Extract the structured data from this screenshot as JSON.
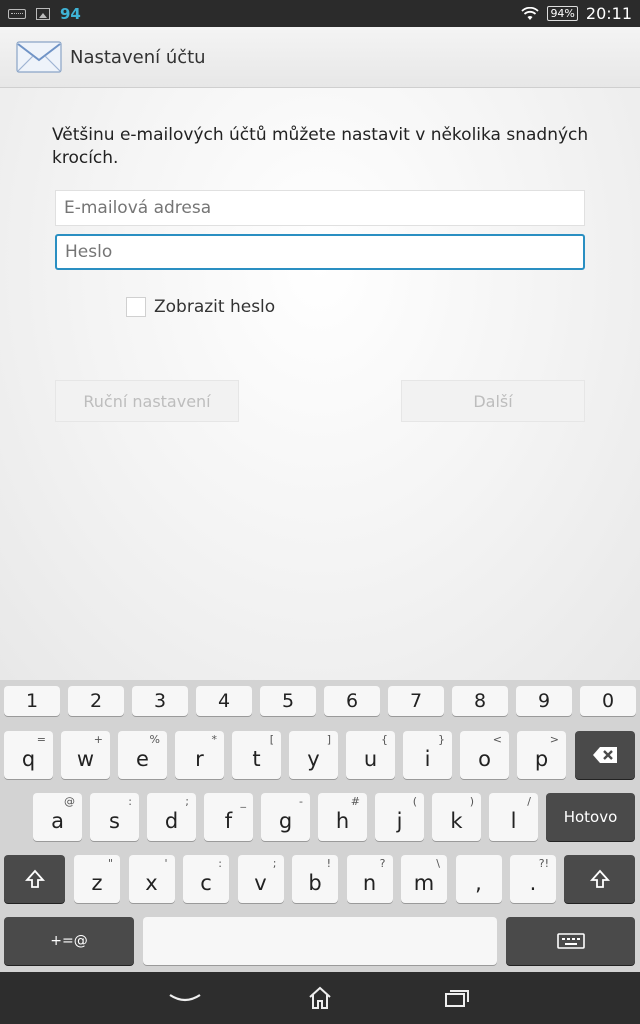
{
  "status_bar": {
    "notification_count": "94",
    "battery": "94%",
    "time": "20:11"
  },
  "action_bar": {
    "title": "Nastavení účtu"
  },
  "form": {
    "intro": "Většinu e-mailových účtů můžete nastavit v několika snadných krocích.",
    "email_placeholder": "E-mailová adresa",
    "password_placeholder": "Heslo",
    "show_password_label": "Zobrazit heslo",
    "manual_setup_label": "Ruční nastavení",
    "next_label": "Další"
  },
  "keyboard": {
    "numbers": [
      "1",
      "2",
      "3",
      "4",
      "5",
      "6",
      "7",
      "8",
      "9",
      "0"
    ],
    "row1": [
      {
        "k": "q",
        "s": "="
      },
      {
        "k": "w",
        "s": "+"
      },
      {
        "k": "e",
        "s": "%"
      },
      {
        "k": "r",
        "s": "*"
      },
      {
        "k": "t",
        "s": "["
      },
      {
        "k": "y",
        "s": "]"
      },
      {
        "k": "u",
        "s": "{"
      },
      {
        "k": "i",
        "s": "}"
      },
      {
        "k": "o",
        "s": "<"
      },
      {
        "k": "p",
        "s": ">"
      }
    ],
    "row2": [
      {
        "k": "a",
        "s": "@"
      },
      {
        "k": "s",
        "s": ":"
      },
      {
        "k": "d",
        "s": ";"
      },
      {
        "k": "f",
        "s": "_"
      },
      {
        "k": "g",
        "s": "-"
      },
      {
        "k": "h",
        "s": "#"
      },
      {
        "k": "j",
        "s": "("
      },
      {
        "k": "k",
        "s": ")"
      },
      {
        "k": "l",
        "s": "/"
      }
    ],
    "row3": [
      {
        "k": "z",
        "s": "\""
      },
      {
        "k": "x",
        "s": "'"
      },
      {
        "k": "c",
        "s": ":"
      },
      {
        "k": "v",
        "s": ";"
      },
      {
        "k": "b",
        "s": "!"
      },
      {
        "k": "n",
        "s": "?"
      },
      {
        "k": "m",
        "s": "\\"
      },
      {
        "k": ",",
        "s": ""
      },
      {
        "k": ".",
        "s": "?!"
      }
    ],
    "done_label": "Hotovo",
    "symbols_label": "+=@"
  },
  "colors": {
    "accent": "#2a8fc2",
    "status_bar": "#2b2b2b",
    "nav_bar": "#2d2d2d"
  },
  "icons": [
    "keyboard-status-icon",
    "image-status-icon",
    "wifi-icon",
    "battery-icon",
    "email-app-icon",
    "backspace-icon",
    "shift-icon",
    "keyboard-settings-icon",
    "back-icon",
    "home-icon",
    "recents-icon"
  ]
}
